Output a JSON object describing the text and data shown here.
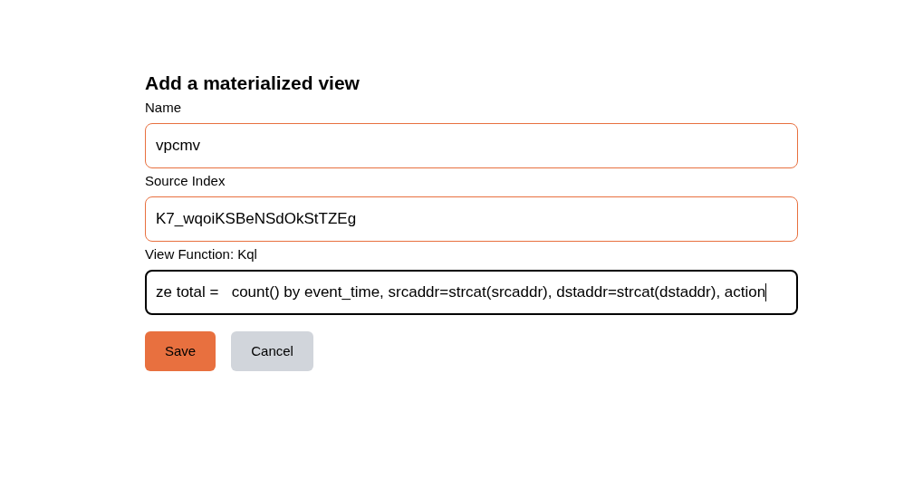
{
  "form": {
    "title": "Add a materialized view",
    "fields": [
      {
        "label": "Name",
        "value": "vpcmv",
        "focused": false
      },
      {
        "label": "Source Index",
        "value": "K7_wqoiKSBeNSdOkStTZEg",
        "focused": false
      },
      {
        "label": "View Function: Kql",
        "value": "ze total =   count() by event_time, srcaddr=strcat(srcaddr), dstaddr=strcat(dstaddr), action",
        "focused": true
      }
    ],
    "buttons": [
      {
        "label": "Save",
        "kind": "primary"
      },
      {
        "label": "Cancel",
        "kind": "secondary"
      }
    ]
  }
}
